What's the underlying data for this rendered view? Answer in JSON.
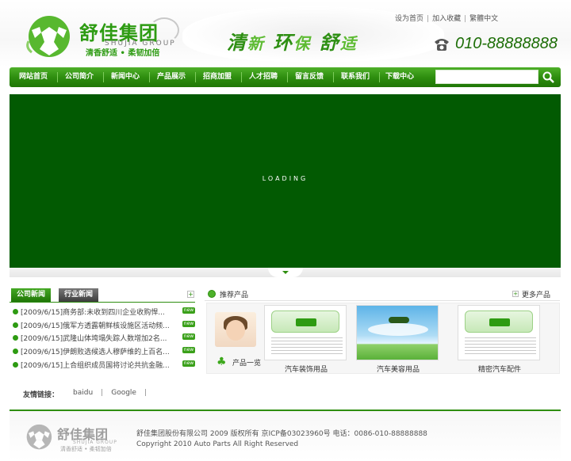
{
  "header": {
    "logo_cn": "舒佳集团",
    "logo_en": "SHUJIA GROUP",
    "logo_slogan": "清香舒适 • 柔韧加倍",
    "slogan_1": "清",
    "slogan_2": "新",
    "slogan_3": "环",
    "slogan_4": "保",
    "slogan_5": "舒",
    "slogan_6": "适",
    "top_links": [
      "设为首页",
      "加入收藏",
      "繁體中文"
    ],
    "phone": "010-88888888",
    "phone_icon": "phone-icon"
  },
  "nav": {
    "items": [
      "网站首页",
      "公司简介",
      "新闻中心",
      "产品展示",
      "招商加盟",
      "人才招聘",
      "留言反馈",
      "联系我们",
      "下载中心"
    ],
    "search_placeholder": "",
    "search_icon": "search-icon"
  },
  "banner": {
    "loading_text": "LOADING",
    "background_color": "#025a02"
  },
  "news": {
    "tabs": [
      "公司新闻",
      "行业新闻"
    ],
    "plus": "+",
    "items": [
      {
        "text": "[2009/6/15]商务部:未收到四川企业收购悍...",
        "badge": "new"
      },
      {
        "text": "[2009/6/15]俄军方透露朝鲜核设施区活动频...",
        "badge": "new"
      },
      {
        "text": "[2009/6/15]武隆山体垮塌失踪人数增加2名...",
        "badge": "new"
      },
      {
        "text": "[2009/6/15]伊朗败选候选人穆萨维的上百名...",
        "badge": "new"
      },
      {
        "text": "[2009/6/15]上合组织成员国将讨论共抗金融...",
        "badge": "new"
      }
    ]
  },
  "products": {
    "title": "推荐产品",
    "more": "更多产品",
    "list_label": "产品一览",
    "items": [
      {
        "name": "汽车装饰用品"
      },
      {
        "name": "汽车美容用品"
      },
      {
        "name": "精密汽车配件"
      }
    ]
  },
  "links": {
    "label": "友情链接：",
    "items": [
      "baidu",
      "Google"
    ],
    "separator": "|"
  },
  "footer": {
    "line1": "舒佳集团股份有限公司 2009 版权所有 京ICP备03023960号 电话：0086-010-88888888",
    "line2": "Copyright 2010 Auto Parts All Right Reserved",
    "logo_cn": "舒佳集团",
    "logo_en": "SHUJIA GROUP",
    "logo_slogan": "清香舒适 • 柔韧加倍"
  },
  "colors": {
    "brand_green": "#2e8e0f",
    "light_green": "#4fb02a",
    "banner": "#025a02"
  }
}
